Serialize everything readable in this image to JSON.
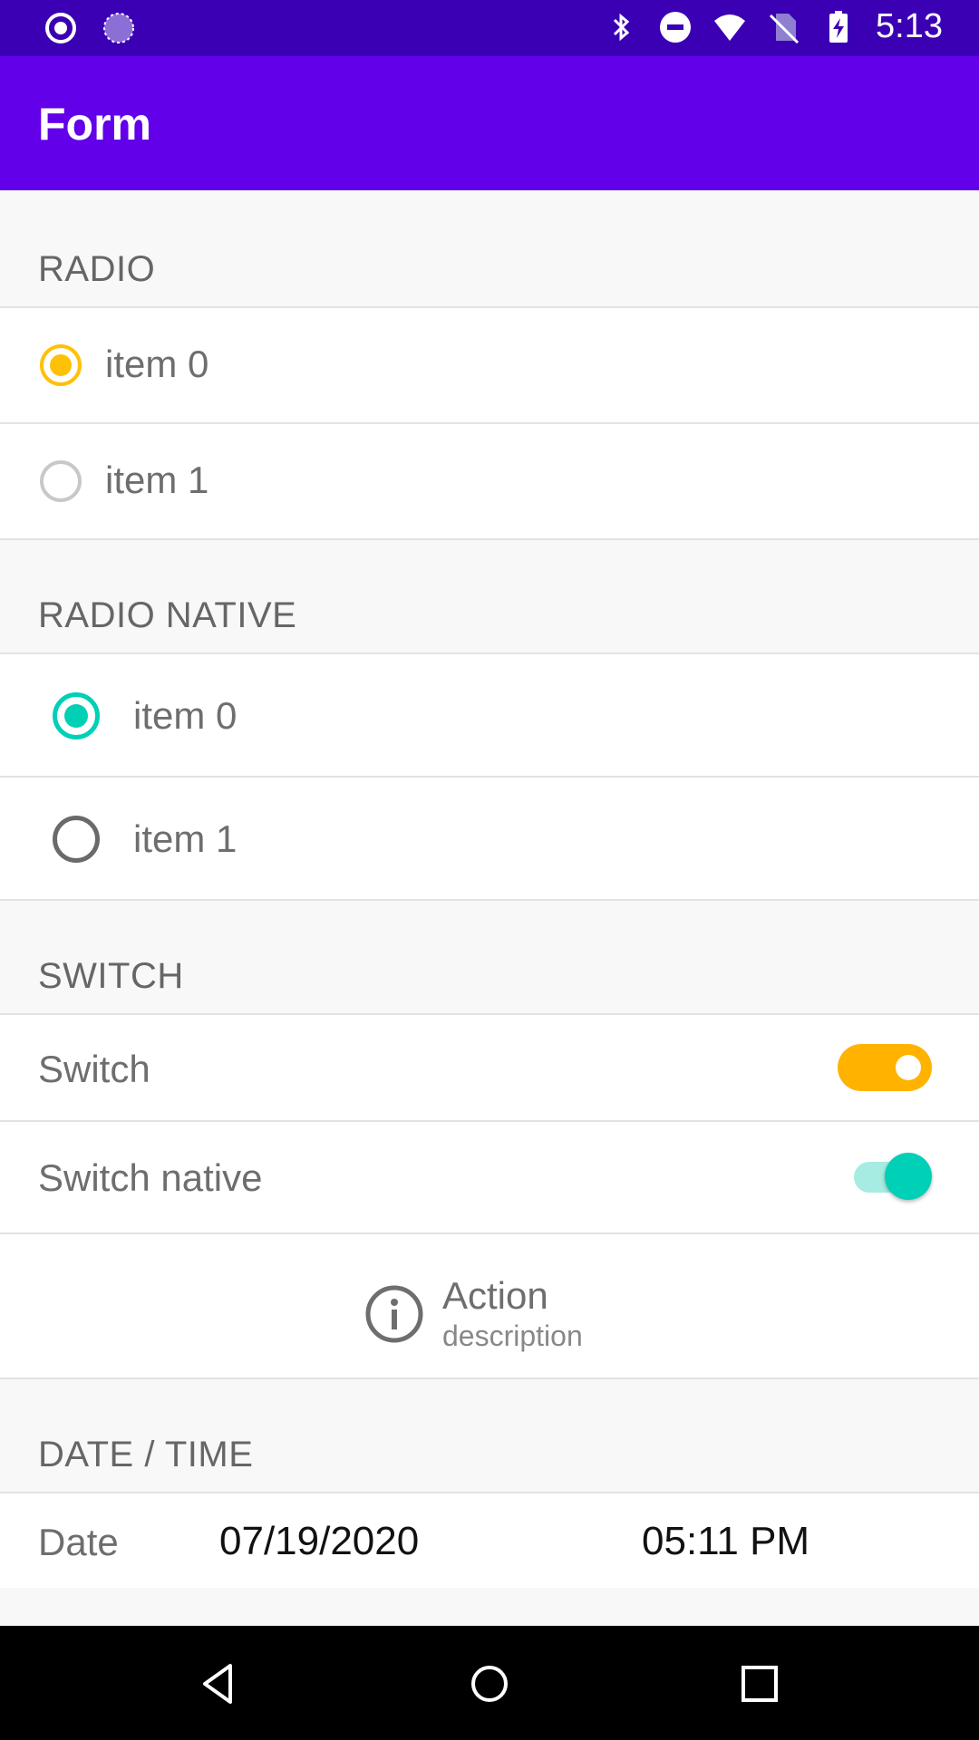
{
  "status_bar": {
    "time": "5:13",
    "left_icons": [
      "record-icon",
      "loading-icon"
    ],
    "right_icons": [
      "bluetooth-icon",
      "do-not-disturb-icon",
      "wifi-icon",
      "no-sim-icon",
      "battery-charging-icon"
    ]
  },
  "app_bar": {
    "title": "Form"
  },
  "radio": {
    "header": "RADIO",
    "items": [
      {
        "label": "item 0",
        "selected": true
      },
      {
        "label": "item 1",
        "selected": false
      }
    ]
  },
  "radio_native": {
    "header": "RADIO NATIVE",
    "items": [
      {
        "label": "item 0",
        "selected": true
      },
      {
        "label": "item 1",
        "selected": false
      }
    ]
  },
  "switch": {
    "header": "SWITCH",
    "switch_label": "Switch",
    "switch_on": true,
    "switch_native_label": "Switch native",
    "switch_native_on": true
  },
  "action": {
    "title": "Action",
    "description": "description",
    "icon": "info-icon"
  },
  "date_time": {
    "header": "DATE / TIME",
    "label": "Date",
    "date": "07/19/2020",
    "time": "05:11 PM"
  },
  "nav_bar": {
    "buttons": [
      "back-icon",
      "home-icon",
      "recents-icon"
    ]
  },
  "colors": {
    "status_bar": "#3b00b3",
    "app_bar": "#6200ea",
    "custom_accent": "#ffb300",
    "native_accent": "#00d0b5"
  }
}
